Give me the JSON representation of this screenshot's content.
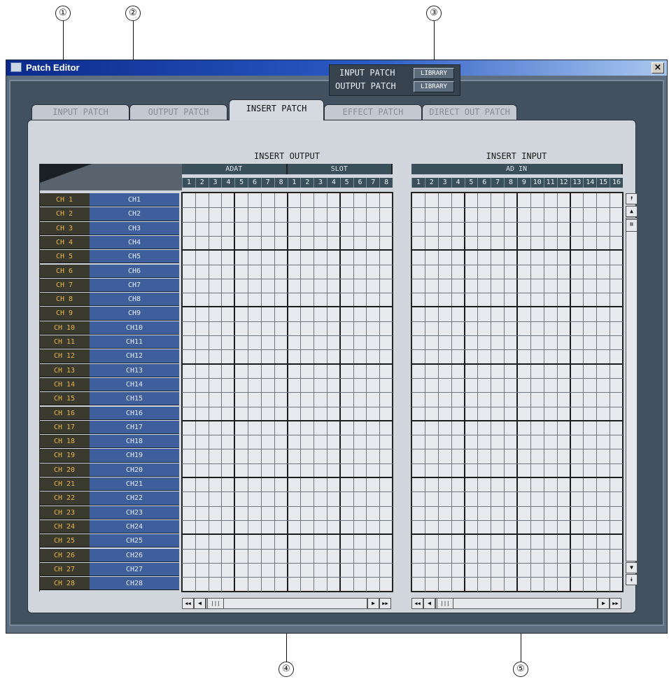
{
  "window": {
    "title": "Patch Editor",
    "close_label": "×"
  },
  "tabs": [
    {
      "label": "INPUT PATCH",
      "active": false
    },
    {
      "label": "OUTPUT PATCH",
      "active": false
    },
    {
      "label": "INSERT PATCH",
      "active": true
    },
    {
      "label": "EFFECT PATCH",
      "active": false
    },
    {
      "label": "DIRECT OUT PATCH",
      "active": false
    }
  ],
  "library": {
    "input_label": "INPUT PATCH",
    "output_label": "OUTPUT PATCH",
    "button_label": "LIBRARY"
  },
  "insert_output": {
    "title": "INSERT OUTPUT",
    "groups": [
      {
        "name": "ADAT",
        "columns": [
          "1",
          "2",
          "3",
          "4",
          "5",
          "6",
          "7",
          "8"
        ]
      },
      {
        "name": "SLOT",
        "columns": [
          "1",
          "2",
          "3",
          "4",
          "5",
          "6",
          "7",
          "8"
        ]
      }
    ]
  },
  "insert_input": {
    "title": "INSERT INPUT",
    "groups": [
      {
        "name": "AD IN",
        "columns": [
          "1",
          "2",
          "3",
          "4",
          "5",
          "6",
          "7",
          "8",
          "9",
          "10",
          "11",
          "12",
          "13",
          "14",
          "15",
          "16"
        ]
      }
    ]
  },
  "channels": [
    {
      "num": "CH 1",
      "name": "CH1"
    },
    {
      "num": "CH 2",
      "name": "CH2"
    },
    {
      "num": "CH 3",
      "name": "CH3"
    },
    {
      "num": "CH 4",
      "name": "CH4"
    },
    {
      "num": "CH 5",
      "name": "CH5"
    },
    {
      "num": "CH 6",
      "name": "CH6"
    },
    {
      "num": "CH 7",
      "name": "CH7"
    },
    {
      "num": "CH 8",
      "name": "CH8"
    },
    {
      "num": "CH 9",
      "name": "CH9"
    },
    {
      "num": "CH 10",
      "name": "CH10"
    },
    {
      "num": "CH 11",
      "name": "CH11"
    },
    {
      "num": "CH 12",
      "name": "CH12"
    },
    {
      "num": "CH 13",
      "name": "CH13"
    },
    {
      "num": "CH 14",
      "name": "CH14"
    },
    {
      "num": "CH 15",
      "name": "CH15"
    },
    {
      "num": "CH 16",
      "name": "CH16"
    },
    {
      "num": "CH 17",
      "name": "CH17"
    },
    {
      "num": "CH 18",
      "name": "CH18"
    },
    {
      "num": "CH 19",
      "name": "CH19"
    },
    {
      "num": "CH 20",
      "name": "CH20"
    },
    {
      "num": "CH 21",
      "name": "CH21"
    },
    {
      "num": "CH 22",
      "name": "CH22"
    },
    {
      "num": "CH 23",
      "name": "CH23"
    },
    {
      "num": "CH 24",
      "name": "CH24"
    },
    {
      "num": "CH 25",
      "name": "CH25"
    },
    {
      "num": "CH 26",
      "name": "CH26"
    },
    {
      "num": "CH 27",
      "name": "CH27"
    },
    {
      "num": "CH 28",
      "name": "CH28"
    }
  ],
  "callouts": [
    "①",
    "②",
    "③",
    "④",
    "⑤"
  ],
  "icons": {
    "scroll_top": "top-arrow-icon",
    "scroll_up": "up-arrow-icon",
    "scroll_down": "down-arrow-icon",
    "scroll_bottom": "bottom-arrow-icon",
    "scroll_first": "first-arrow-icon",
    "scroll_left": "left-arrow-icon",
    "scroll_right": "right-arrow-icon",
    "scroll_last": "last-arrow-icon"
  }
}
